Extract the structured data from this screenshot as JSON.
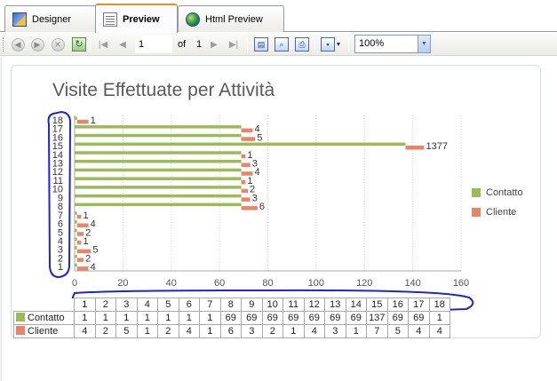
{
  "tabs": [
    {
      "label": "Designer",
      "icon": "designer-icon",
      "active": false
    },
    {
      "label": "Preview",
      "icon": "preview-icon",
      "active": true
    },
    {
      "label": "Html Preview",
      "icon": "globe-icon",
      "active": false
    }
  ],
  "toolbar": {
    "page_value": "1",
    "of_label": "of",
    "total_pages": "1",
    "zoom_value": "100%"
  },
  "colors": {
    "contatto": "#9bbb59",
    "cliente": "#e8846a",
    "annotation": "#1d26c9"
  },
  "chart_data": {
    "type": "bar",
    "orientation": "horizontal",
    "title": "Visite Effettuate per Attività",
    "categories": [
      "1",
      "2",
      "3",
      "4",
      "5",
      "6",
      "7",
      "8",
      "9",
      "10",
      "11",
      "12",
      "13",
      "14",
      "15",
      "16",
      "17",
      "18"
    ],
    "series": [
      {
        "name": "Contatto",
        "values": [
          1,
          1,
          1,
          1,
          1,
          1,
          1,
          69,
          69,
          69,
          69,
          69,
          69,
          69,
          137,
          69,
          69,
          1
        ]
      },
      {
        "name": "Cliente",
        "values": [
          4,
          2,
          5,
          1,
          2,
          4,
          1,
          6,
          3,
          2,
          1,
          4,
          3,
          1,
          7,
          5,
          4,
          4
        ]
      }
    ],
    "xlim": [
      0,
      160
    ],
    "xticks": [
      "0",
      "20",
      "40",
      "60",
      "80",
      "100",
      "120",
      "140",
      "160"
    ],
    "bar_labels": [
      "4",
      "2",
      "5",
      "1",
      "2",
      "4",
      "1",
      "6",
      "3",
      "2",
      "1",
      "4",
      "3",
      "1",
      "1377",
      "5",
      "4",
      "1"
    ],
    "legend_position": "right",
    "grid": true
  },
  "table": {
    "headers": [
      "1",
      "2",
      "3",
      "4",
      "5",
      "6",
      "7",
      "8",
      "9",
      "10",
      "11",
      "12",
      "13",
      "14",
      "15",
      "16",
      "17",
      "18"
    ],
    "rows": [
      {
        "label": "Contatto",
        "values": [
          "1",
          "1",
          "1",
          "1",
          "1",
          "1",
          "1",
          "69",
          "69",
          "69",
          "69",
          "69",
          "69",
          "69",
          "137",
          "69",
          "69",
          "1"
        ]
      },
      {
        "label": "Cliente",
        "values": [
          "4",
          "2",
          "5",
          "1",
          "2",
          "4",
          "1",
          "6",
          "3",
          "2",
          "1",
          "4",
          "3",
          "1",
          "7",
          "5",
          "4",
          "4"
        ]
      }
    ]
  }
}
